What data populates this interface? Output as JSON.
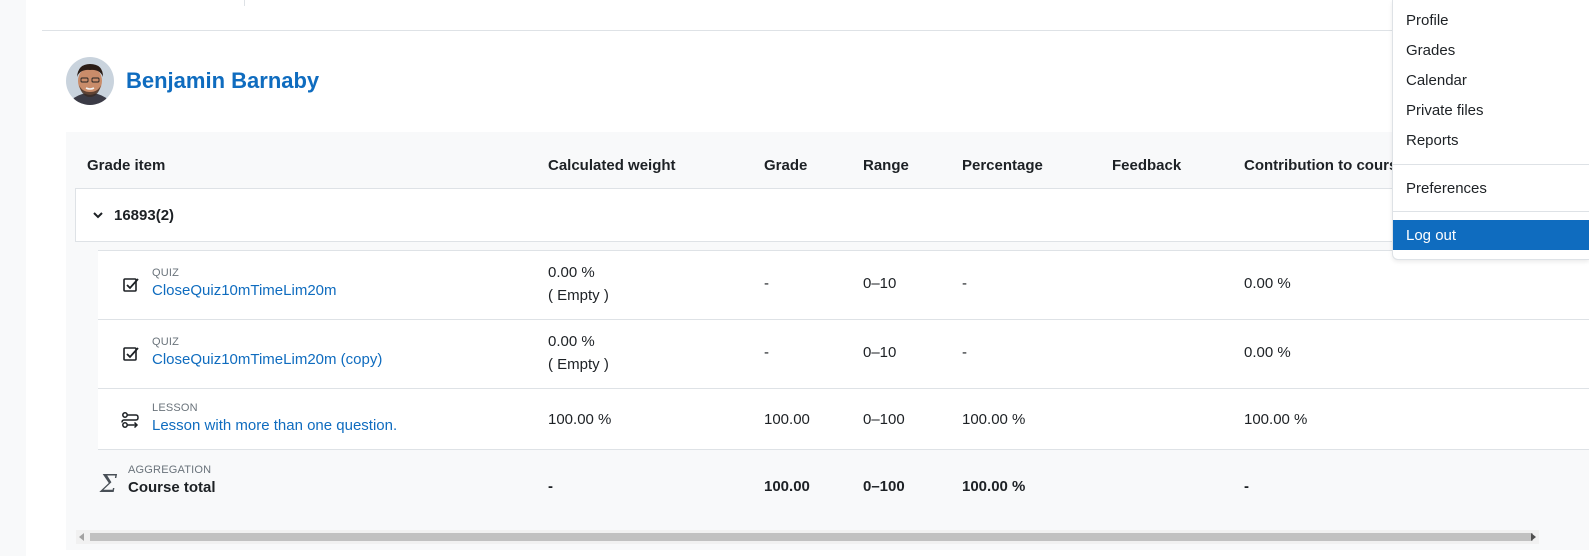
{
  "user": {
    "name": "Benjamin Barnaby"
  },
  "table": {
    "headers": {
      "grade_item": "Grade item",
      "calculated_weight": "Calculated weight",
      "grade": "Grade",
      "range": "Range",
      "percentage": "Percentage",
      "feedback": "Feedback",
      "contribution": "Contribution to cours"
    },
    "category": {
      "label": "16893(2)"
    },
    "items": [
      {
        "type": "QUIZ",
        "name": "CloseQuiz10mTimeLim20m",
        "weight": "0.00 %",
        "weight_note": "( Empty )",
        "grade": "-",
        "range": "0–10",
        "percentage": "-",
        "contribution": "0.00 %"
      },
      {
        "type": "QUIZ",
        "name": "CloseQuiz10mTimeLim20m (copy)",
        "weight": "0.00 %",
        "weight_note": "( Empty )",
        "grade": "-",
        "range": "0–10",
        "percentage": "-",
        "contribution": "0.00 %"
      },
      {
        "type": "LESSON",
        "name": "Lesson with more than one question.",
        "weight": "100.00 %",
        "grade": "100.00",
        "range": "0–100",
        "percentage": "100.00 %",
        "contribution": "100.00 %"
      }
    ],
    "total": {
      "type": "AGGREGATION",
      "name": "Course total",
      "symbol": "Σ",
      "weight": "-",
      "grade": "100.00",
      "range": "0–100",
      "percentage": "100.00 %",
      "contribution": "-"
    }
  },
  "user_menu": {
    "items": [
      "Profile",
      "Grades",
      "Calendar",
      "Private files",
      "Reports"
    ],
    "preferences": "Preferences",
    "logout": "Log out"
  },
  "colors": {
    "accent": "#0f6cbf",
    "border": "#dee2e6",
    "panel": "#f8f9fa"
  }
}
